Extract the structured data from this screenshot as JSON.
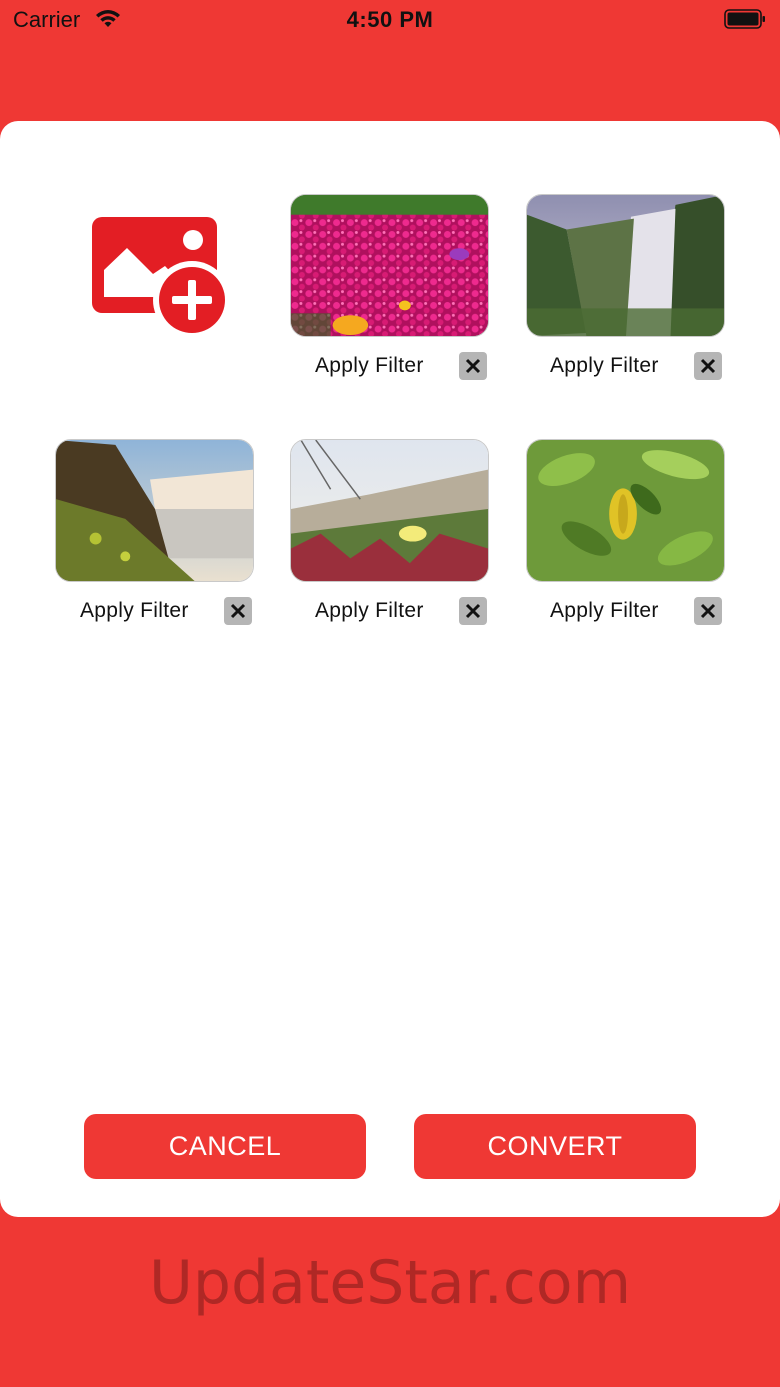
{
  "status_bar": {
    "carrier": "Carrier",
    "time": "4:50 PM"
  },
  "add_photo": {
    "icon": "add-photo-icon"
  },
  "images": [
    {
      "subject": "pink-flowers",
      "filter_label": "Apply Filter",
      "remove_icon": "close-icon"
    },
    {
      "subject": "waterfall-cliff",
      "filter_label": "Apply Filter",
      "remove_icon": "close-icon"
    },
    {
      "subject": "waterfall-coast",
      "filter_label": "Apply Filter",
      "remove_icon": "close-icon"
    },
    {
      "subject": "ice-plant-flowers",
      "filter_label": "Apply Filter",
      "remove_icon": "close-icon"
    },
    {
      "subject": "green-leaves",
      "filter_label": "Apply Filter",
      "remove_icon": "close-icon"
    }
  ],
  "actions": {
    "cancel_label": "CANCEL",
    "convert_label": "CONVERT"
  },
  "watermark": "UpdateStar.com",
  "colors": {
    "brand_red": "#EF3834",
    "card_bg": "#FFFFFF",
    "remove_bg": "#B5B5B5"
  }
}
